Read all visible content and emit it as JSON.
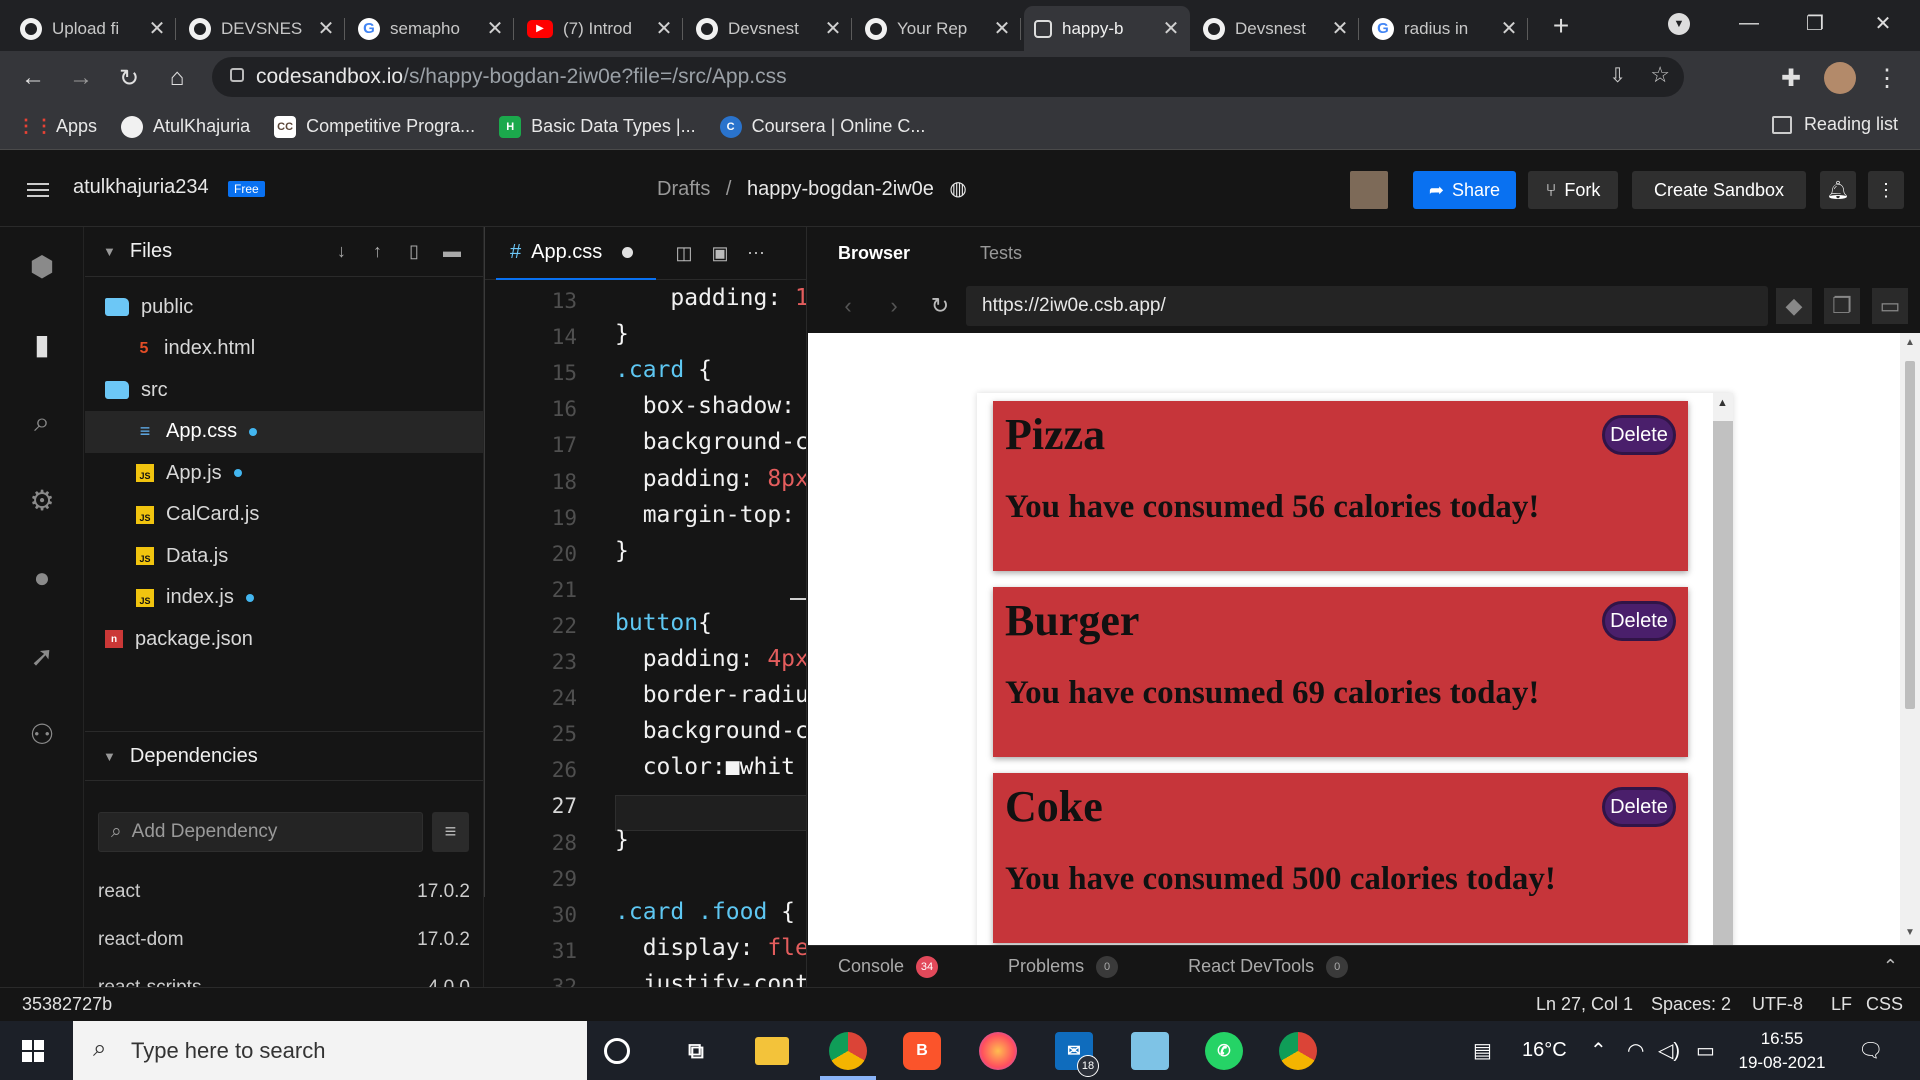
{
  "chrome": {
    "tabs": [
      {
        "title": "Upload fi",
        "icon": "github-icon",
        "active": false
      },
      {
        "title": "DEVSNES",
        "icon": "github-icon",
        "active": false
      },
      {
        "title": "semapho",
        "icon": "google-icon",
        "active": false
      },
      {
        "title": "(7) Introd",
        "icon": "youtube-icon",
        "active": false
      },
      {
        "title": "Devsnest",
        "icon": "github-icon",
        "active": false
      },
      {
        "title": "Your Rep",
        "icon": "github-icon",
        "active": false
      },
      {
        "title": "happy-b",
        "icon": "codesandbox-icon",
        "active": true
      },
      {
        "title": "Devsnest",
        "icon": "github-icon",
        "active": false
      },
      {
        "title": "radius in",
        "icon": "google-icon",
        "active": false
      }
    ],
    "new_tab": "+",
    "url_host": "codesandbox.io",
    "url_rest": "/s/happy-bogdan-2iw0e?file=/src/App.css",
    "bookmarks": [
      {
        "label": "Apps",
        "icon": "apps-grid-icon"
      },
      {
        "label": "AtulKhajuria",
        "icon": "github-icon"
      },
      {
        "label": "Competitive Progra...",
        "icon": "codechef-icon"
      },
      {
        "label": "Basic Data Types |...",
        "icon": "hackerrank-icon"
      },
      {
        "label": "Coursera | Online C...",
        "icon": "coursera-icon"
      }
    ],
    "reading_list": "Reading list"
  },
  "header": {
    "username": "atulkhajuria234",
    "plan_badge": "Free",
    "breadcrumb_folder": "Drafts",
    "breadcrumb_sep": "/",
    "sandbox_name": "happy-bogdan-2iw0e",
    "share": "Share",
    "fork": "Fork",
    "create": "Create Sandbox"
  },
  "explorer": {
    "files_title": "Files",
    "files": [
      {
        "name": "public",
        "icon": "folder-icon",
        "indent": 0,
        "modified": false
      },
      {
        "name": "index.html",
        "icon": "html-file-icon",
        "indent": 1,
        "modified": false
      },
      {
        "name": "src",
        "icon": "folder-icon",
        "indent": 0,
        "modified": false
      },
      {
        "name": "App.css",
        "icon": "css-file-icon",
        "indent": 1,
        "modified": true,
        "selected": true
      },
      {
        "name": "App.js",
        "icon": "js-file-icon",
        "indent": 1,
        "modified": true
      },
      {
        "name": "CalCard.js",
        "icon": "js-file-icon",
        "indent": 1,
        "modified": false
      },
      {
        "name": "Data.js",
        "icon": "js-file-icon",
        "indent": 1,
        "modified": false
      },
      {
        "name": "index.js",
        "icon": "js-file-icon",
        "indent": 1,
        "modified": true
      },
      {
        "name": "package.json",
        "icon": "package-json-icon",
        "indent": 0,
        "modified": false
      }
    ],
    "deps_title": "Dependencies",
    "dep_placeholder": "Add Dependency",
    "deps": [
      {
        "name": "react",
        "version": "17.0.2"
      },
      {
        "name": "react-dom",
        "version": "17.0.2"
      },
      {
        "name": "react-scripts",
        "version": "4.0.0"
      }
    ]
  },
  "editor": {
    "tab": "App.css",
    "lines": [
      {
        "n": "13",
        "parts": [
          {
            "t": "    padding: ",
            "c": "c-prop"
          },
          {
            "t": "1",
            "c": "c-num"
          }
        ]
      },
      {
        "n": "14",
        "parts": [
          {
            "t": "}",
            "c": "c-str"
          }
        ]
      },
      {
        "n": "15",
        "parts": [
          {
            "t": ".card",
            "c": "c-sel"
          },
          {
            "t": " {",
            "c": "c-str"
          }
        ]
      },
      {
        "n": "16",
        "parts": [
          {
            "t": "  box-shadow: ",
            "c": "c-prop"
          }
        ]
      },
      {
        "n": "17",
        "parts": [
          {
            "t": "  background-c",
            "c": "c-prop"
          }
        ]
      },
      {
        "n": "18",
        "parts": [
          {
            "t": "  padding: ",
            "c": "c-prop"
          },
          {
            "t": "8px",
            "c": "c-num"
          }
        ]
      },
      {
        "n": "19",
        "parts": [
          {
            "t": "  margin-top: ",
            "c": "c-prop"
          }
        ]
      },
      {
        "n": "20",
        "parts": [
          {
            "t": "}",
            "c": "c-str"
          }
        ]
      },
      {
        "n": "21",
        "parts": []
      },
      {
        "n": "22",
        "parts": [
          {
            "t": "button",
            "c": "c-sel"
          },
          {
            "t": "{",
            "c": "c-str"
          }
        ]
      },
      {
        "n": "23",
        "parts": [
          {
            "t": "  padding: ",
            "c": "c-prop"
          },
          {
            "t": "4px",
            "c": "c-num"
          }
        ]
      },
      {
        "n": "24",
        "parts": [
          {
            "t": "  border-radiu",
            "c": "c-prop"
          }
        ]
      },
      {
        "n": "25",
        "parts": [
          {
            "t": "  background-c",
            "c": "c-prop"
          }
        ]
      },
      {
        "n": "26",
        "parts": [
          {
            "t": "  color:",
            "c": "c-prop"
          },
          {
            "t": "■",
            "c": "c-str"
          },
          {
            "t": "whit",
            "c": "c-str"
          }
        ]
      },
      {
        "n": "27",
        "parts": []
      },
      {
        "n": "28",
        "parts": [
          {
            "t": "}",
            "c": "c-str"
          }
        ]
      },
      {
        "n": "29",
        "parts": []
      },
      {
        "n": "30",
        "parts": [
          {
            "t": ".card .food",
            "c": "c-sel"
          },
          {
            "t": " {",
            "c": "c-str"
          }
        ]
      },
      {
        "n": "31",
        "parts": [
          {
            "t": "  display: ",
            "c": "c-prop"
          },
          {
            "t": "fle",
            "c": "c-num"
          }
        ]
      },
      {
        "n": "32",
        "parts": [
          {
            "t": "  justify-cont",
            "c": "c-prop"
          }
        ]
      }
    ]
  },
  "preview": {
    "tab_browser": "Browser",
    "tab_tests": "Tests",
    "url": "https://2iw0e.csb.app/",
    "cards": [
      {
        "food": "Pizza",
        "calories": "You have consumed 56 calories today!",
        "button": "Delete"
      },
      {
        "food": "Burger",
        "calories": "You have consumed 69 calories today!",
        "button": "Delete"
      },
      {
        "food": "Coke",
        "calories": "You have consumed 500 calories today!",
        "button": "Delete"
      }
    ],
    "console": "Console",
    "console_count": "34",
    "problems": "Problems",
    "problems_count": "0",
    "devtools": "React DevTools",
    "devtools_count": "0"
  },
  "status": {
    "commit": "35382727b",
    "position": "Ln 27, Col 1",
    "spaces": "Spaces: 2",
    "encoding": "UTF-8",
    "eol": "LF",
    "language": "CSS"
  },
  "taskbar": {
    "search_placeholder": "Type here to search",
    "mail_badge": "18",
    "temperature": "16°C",
    "time": "16:55",
    "date": "19-08-2021"
  },
  "colors": {
    "accent": "#0971f1",
    "card": "#c6353a",
    "delete_button": "#4a1f6b"
  }
}
